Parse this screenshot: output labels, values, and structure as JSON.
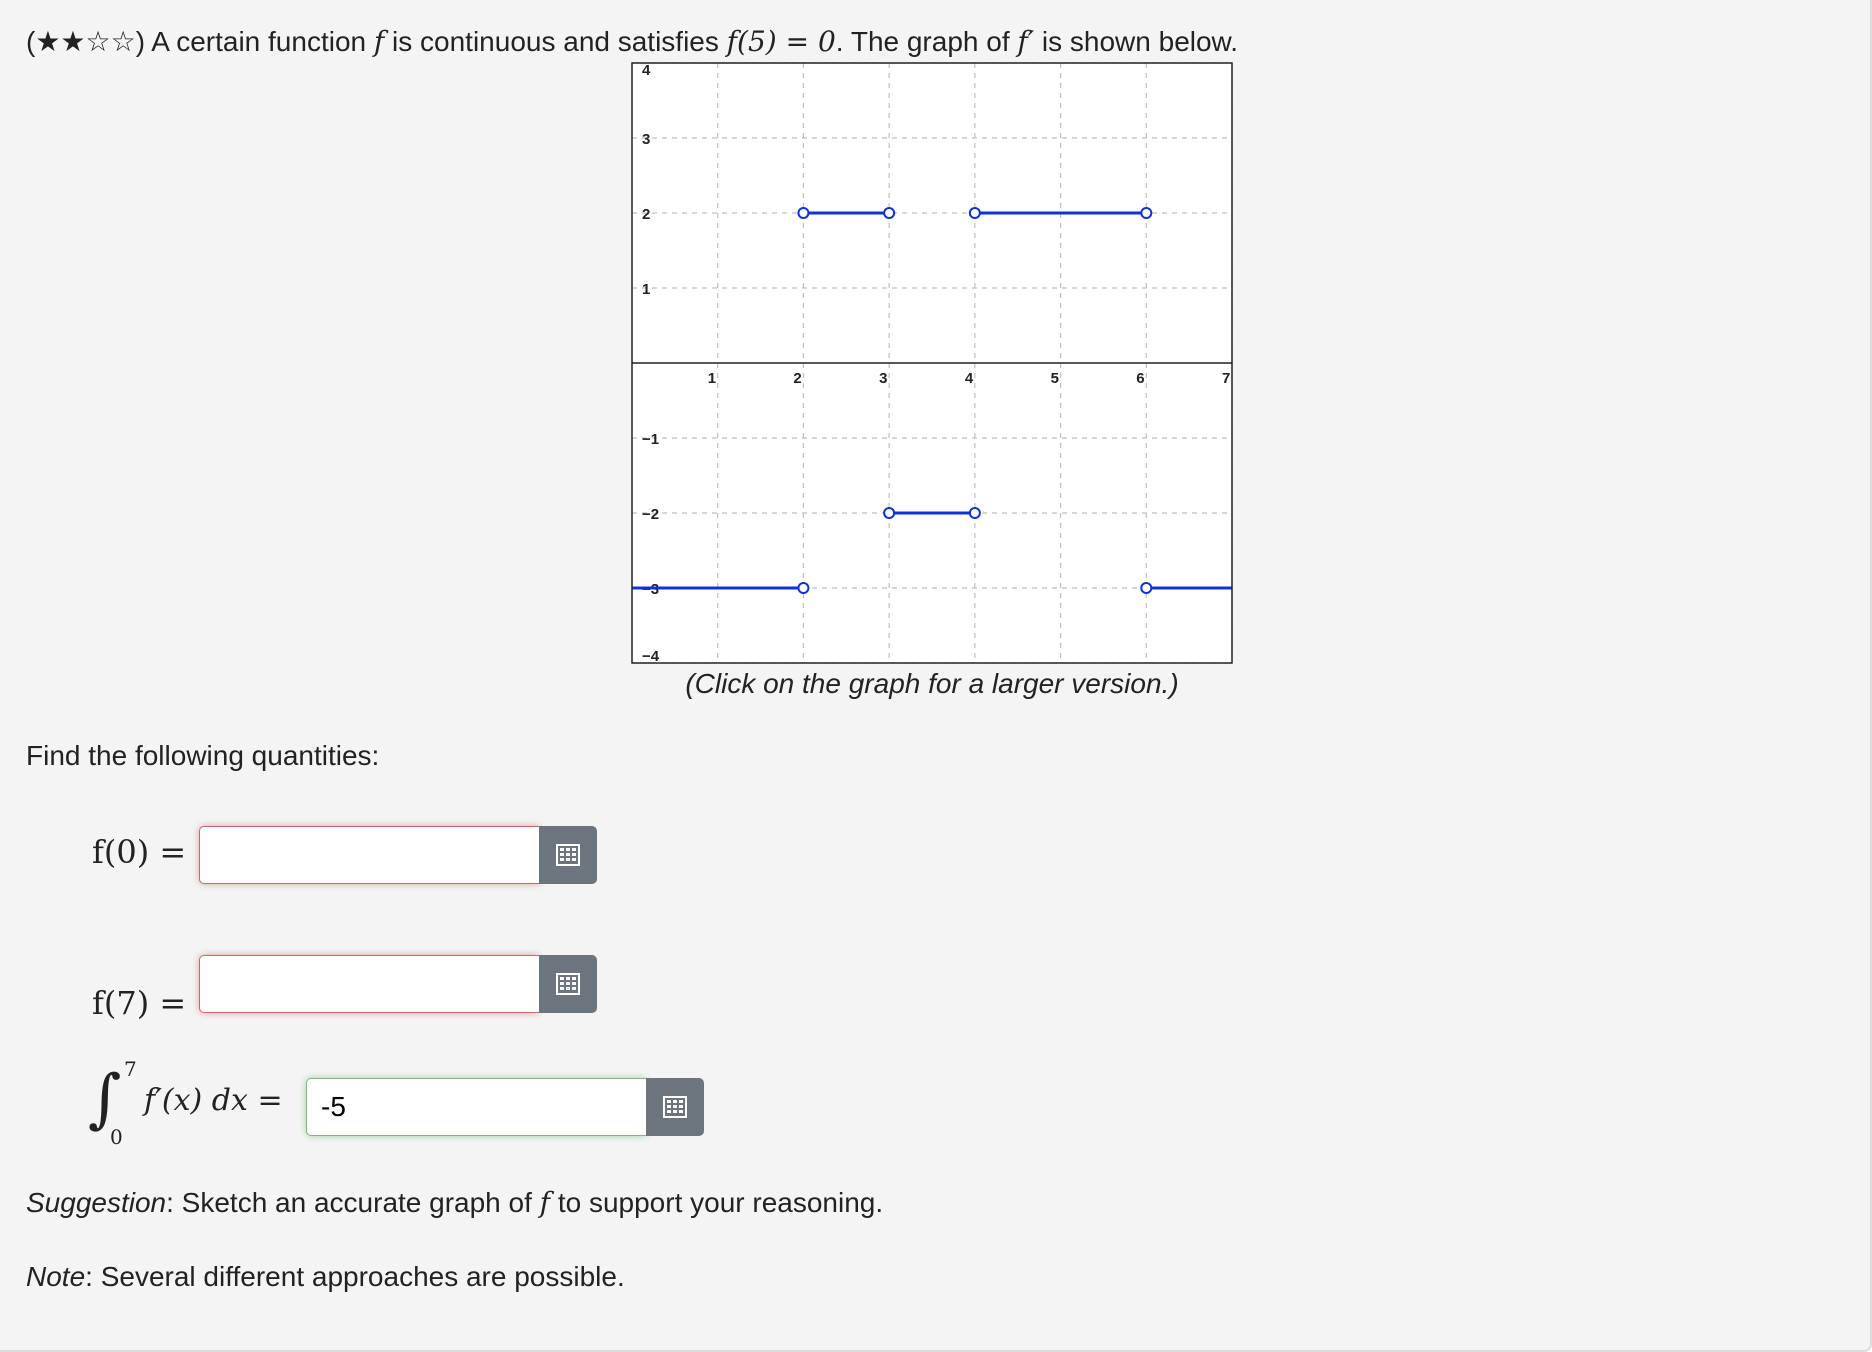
{
  "problem": {
    "stars": "(★★☆☆)",
    "intro": " A certain function ",
    "f": "f",
    "mid": " is continuous and satisfies ",
    "condition": "f(5) = 0",
    "after": ". The graph of ",
    "fprime": "f′",
    "end": " is shown below."
  },
  "graph": {
    "caption": "(Click on the graph for a larger version.)",
    "colors": {
      "line": "#1130d6",
      "grid": "#bfbfbf",
      "axis": "#222222"
    },
    "chart_data": {
      "type": "line",
      "xlim": [
        0,
        7
      ],
      "ylim": [
        -4,
        4
      ],
      "x_ticks": [
        "1",
        "2",
        "3",
        "4",
        "5",
        "6",
        "7"
      ],
      "y_ticks": [
        "4",
        "3",
        "2",
        "1",
        "-1",
        "-2",
        "-3",
        "-4"
      ],
      "grid": true,
      "segments": [
        {
          "x": [
            0,
            2
          ],
          "y": -3,
          "open_ends": [
            false,
            true
          ]
        },
        {
          "x": [
            2,
            3
          ],
          "y": 2,
          "open_ends": [
            true,
            true
          ]
        },
        {
          "x": [
            3,
            4
          ],
          "y": -2,
          "open_ends": [
            true,
            true
          ]
        },
        {
          "x": [
            4,
            6
          ],
          "y": 2,
          "open_ends": [
            true,
            true
          ]
        },
        {
          "x": [
            6,
            7
          ],
          "y": -3,
          "open_ends": [
            true,
            false
          ]
        }
      ]
    }
  },
  "find_label": "Find the following quantities:",
  "questions": [
    {
      "label": "f(0) =",
      "value": "",
      "status": "incorrect"
    },
    {
      "label": "f(7) =",
      "value": "",
      "status": "incorrect"
    },
    {
      "label_integrand": "f′(x) dx =",
      "upper": "7",
      "lower": "0",
      "value": "-5",
      "status": "correct"
    }
  ],
  "suggestion": {
    "lead": "Suggestion",
    "text1": ": Sketch an accurate graph of ",
    "f": "f",
    "text2": " to support your reasoning."
  },
  "note": {
    "lead": "Note",
    "text": ": Several different approaches are possible."
  }
}
